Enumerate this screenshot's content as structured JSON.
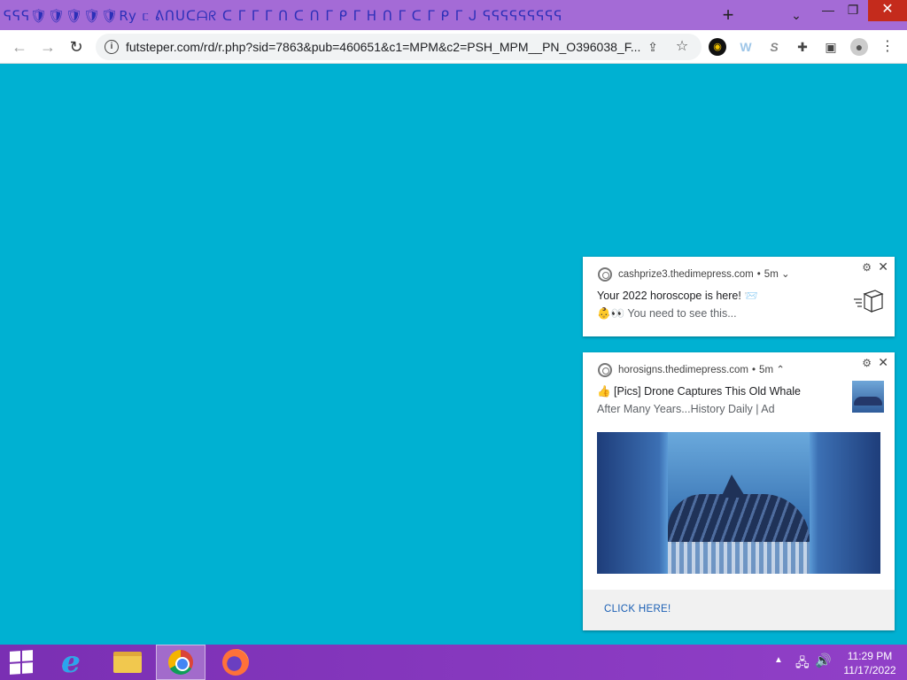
{
  "browser": {
    "tab_strip_text": "ᕋᕋᕋ🛡🛡🛡🛡🛡Ry  ᥴ ᕕᑎᑌᑕᗩᖇ  ᑕ ᒥ ᒥ ᒥ ᑎ ᑕ ᑎ ᒥ ᑭ ᒥ ᕼ ᑎ ᒥ ᑕ ᒥ ᑭ ᒥ ᒍ ᕋᕋᕋᕋᕋᕋᕋᕋᕋ",
    "new_tab_glyph": "+",
    "tab_search_glyph": "⌄",
    "minimize_glyph": "—",
    "maximize_glyph": "❐",
    "close_glyph": "✕",
    "back_glyph": "←",
    "forward_glyph": "→",
    "reload_glyph": "↻",
    "url": "futsteper.com/rd/r.php?sid=7863&pub=460651&c1=MPM&c2=PSH_MPM__PN_O396038_F...",
    "info_glyph": "i",
    "share_glyph": "⇪",
    "star_glyph": "☆",
    "ext_glyphs": [
      "◉",
      "W",
      "S",
      "✚",
      "▣",
      "●",
      "⋮"
    ]
  },
  "notifications": [
    {
      "source": "cashprize3.thedimepress.com",
      "age": "5m",
      "chevron": "⌄",
      "title": "Your 2022 horoscope is here! 📨",
      "body": "👶👀 You need to see this...",
      "gear": "⚙",
      "close": "✕",
      "icon": "package-icon"
    },
    {
      "source": "horosigns.thedimepress.com",
      "age": "5m",
      "chevron": "⌃",
      "title": "👍 [Pics] Drone Captures This Old Whale",
      "body": "After Many Years...History Daily | Ad",
      "gear": "⚙",
      "close": "✕",
      "action": "CLICK HERE!"
    }
  ],
  "taskbar": {
    "tray_up": "▲",
    "tray_net": "🖧",
    "tray_vol": "🔊",
    "time": "11:29 PM",
    "date": "11/17/2022"
  }
}
